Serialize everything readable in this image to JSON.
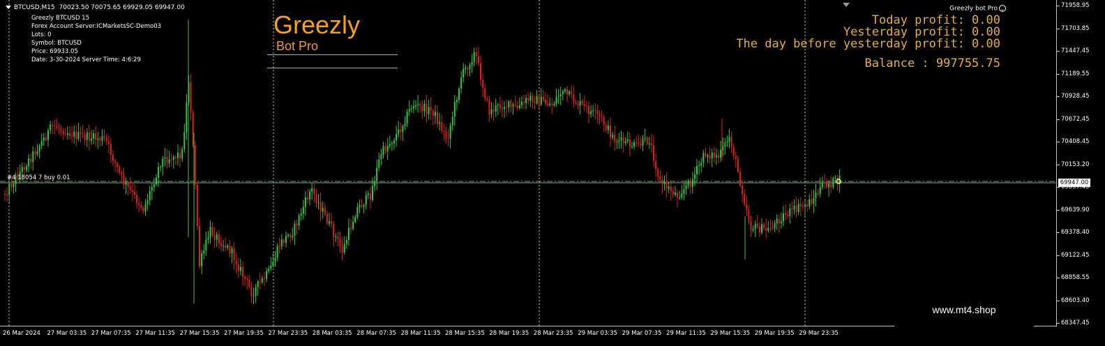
{
  "window": {
    "symbol_timeframe": "BTCUSD,M15",
    "ohlc": "70023.50 70075.65 69929.05 69947.00",
    "bot_label": "Greezly bot Pro"
  },
  "info": {
    "line1": "Greezly  BTCUSD  15",
    "line2": "Forex Account Server:ICMarketsSC-Demo03",
    "line3": "Lots:  0",
    "line4": "Symbol: BTCUSD",
    "line5": "Price:  69933.05",
    "line6": "Date: 3-30-2024 Server Time: 4:6:29"
  },
  "brand": {
    "title": "Greezly",
    "subtitle": "Bot Pro"
  },
  "profits": {
    "today": "Today profit: 0.00",
    "yesterday": "Yesterday profit: 0.00",
    "day_before": "The day before yesterday profit: 0.00",
    "balance": "Balance : 997755.75"
  },
  "order": {
    "label": "#4 18054 7 buy 0.01"
  },
  "watermark": "www.mt4.shop",
  "price_axis": {
    "ticks": [
      "71958.95",
      "71703.85",
      "71447.45",
      "71189.55",
      "70928.45",
      "70672.45",
      "70408.45",
      "70153.20",
      "69897.45",
      "69639.90",
      "69378.40",
      "69122.45",
      "68858.55",
      "68603.40",
      "68347.45"
    ],
    "current": "69947.00"
  },
  "time_axis": {
    "ticks": [
      "26 Mar 2024",
      "27 Mar 03:35",
      "27 Mar 07:35",
      "27 Mar 11:35",
      "27 Mar 15:35",
      "27 Mar 19:35",
      "27 Mar 23:35",
      "28 Mar 03:35",
      "28 Mar 07:35",
      "28 Mar 11:35",
      "28 Mar 15:35",
      "28 Mar 19:35",
      "28 Mar 23:35",
      "29 Mar 03:35",
      "29 Mar 07:35",
      "29 Mar 11:35",
      "29 Mar 15:35",
      "29 Mar 19:35",
      "29 Mar 23:35"
    ]
  },
  "colors": {
    "bull": "#2ecc40",
    "bear": "#e02020",
    "accent": "#f5a11c",
    "profit_text": "#e2b13c",
    "order_line": "#3ec43e"
  }
}
